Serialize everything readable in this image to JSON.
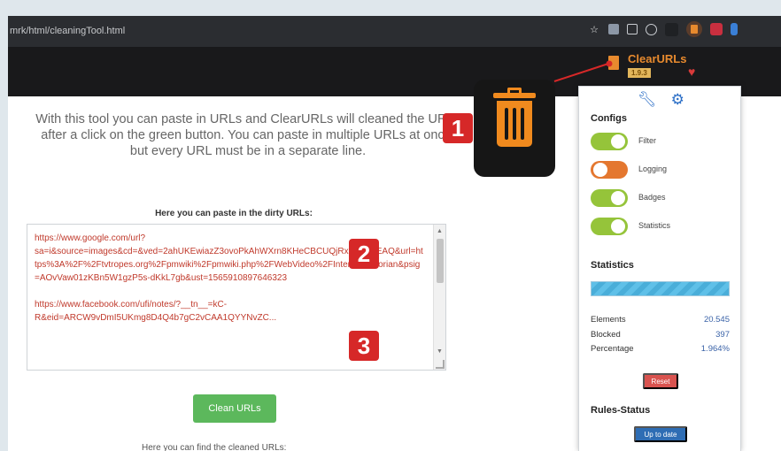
{
  "browser": {
    "url": "mrk/html/cleaningTool.html"
  },
  "page": {
    "intro": "With this tool you can paste in URLs and ClearURLs will cleaned the URLs after a click on the green button. You can paste in multiple URLs at once, but every URL must be in a separate line.",
    "dirty_label": "Here you can paste in the dirty URLs:",
    "textarea_lines": [
      "https://www.google.com/url?",
      "sa=i&source=images&cd=&ved=2ahUKEwiazZ3ovoPkAhWXrn8KHeCBCUQjRx6BAgBEAQ&url=https%3A%2F%2Ftvtropes.org%2Fpmwiki%2Fpmwiki.php%2FWebVideo%2FInternetHistorian&psig=AOvVaw01zKBn5W1gzP5s-dKkL7gb&ust=1565910897646323",
      "",
      "https://www.facebook.com/ufi/notes/?__tn__=kC-",
      "R&eid=ARCW9vDmI5UKmg8D4Q4b7gC2vCAA1QYYNvZC..."
    ],
    "clean_button": "Clean URLs",
    "below_text": "Here you can find the cleaned URLs:"
  },
  "popup": {
    "title": "ClearURLs",
    "version": "1.9.3",
    "configs_title": "Configs",
    "toggles": [
      {
        "label": "Filter",
        "state": "on"
      },
      {
        "label": "Logging",
        "state": "off"
      },
      {
        "label": "Badges",
        "state": "on"
      },
      {
        "label": "Statistics",
        "state": "on"
      }
    ],
    "statistics_title": "Statistics",
    "progress_fraction": 1.0,
    "stats": [
      {
        "label": "Elements",
        "value": "20.545"
      },
      {
        "label": "Blocked",
        "value": "397"
      },
      {
        "label": "Percentage",
        "value": "1.964%"
      }
    ],
    "reset_button": "Reset",
    "rules_title": "Rules-Status",
    "rules_button": "Up to date"
  },
  "callouts": [
    "1",
    "2",
    "3"
  ],
  "colors": {
    "accent_orange": "#f08a1e",
    "toggle_on": "#95c43a",
    "toggle_off": "#e4772f",
    "callout_red": "#d62828",
    "clean_button": "#5cb85c"
  }
}
